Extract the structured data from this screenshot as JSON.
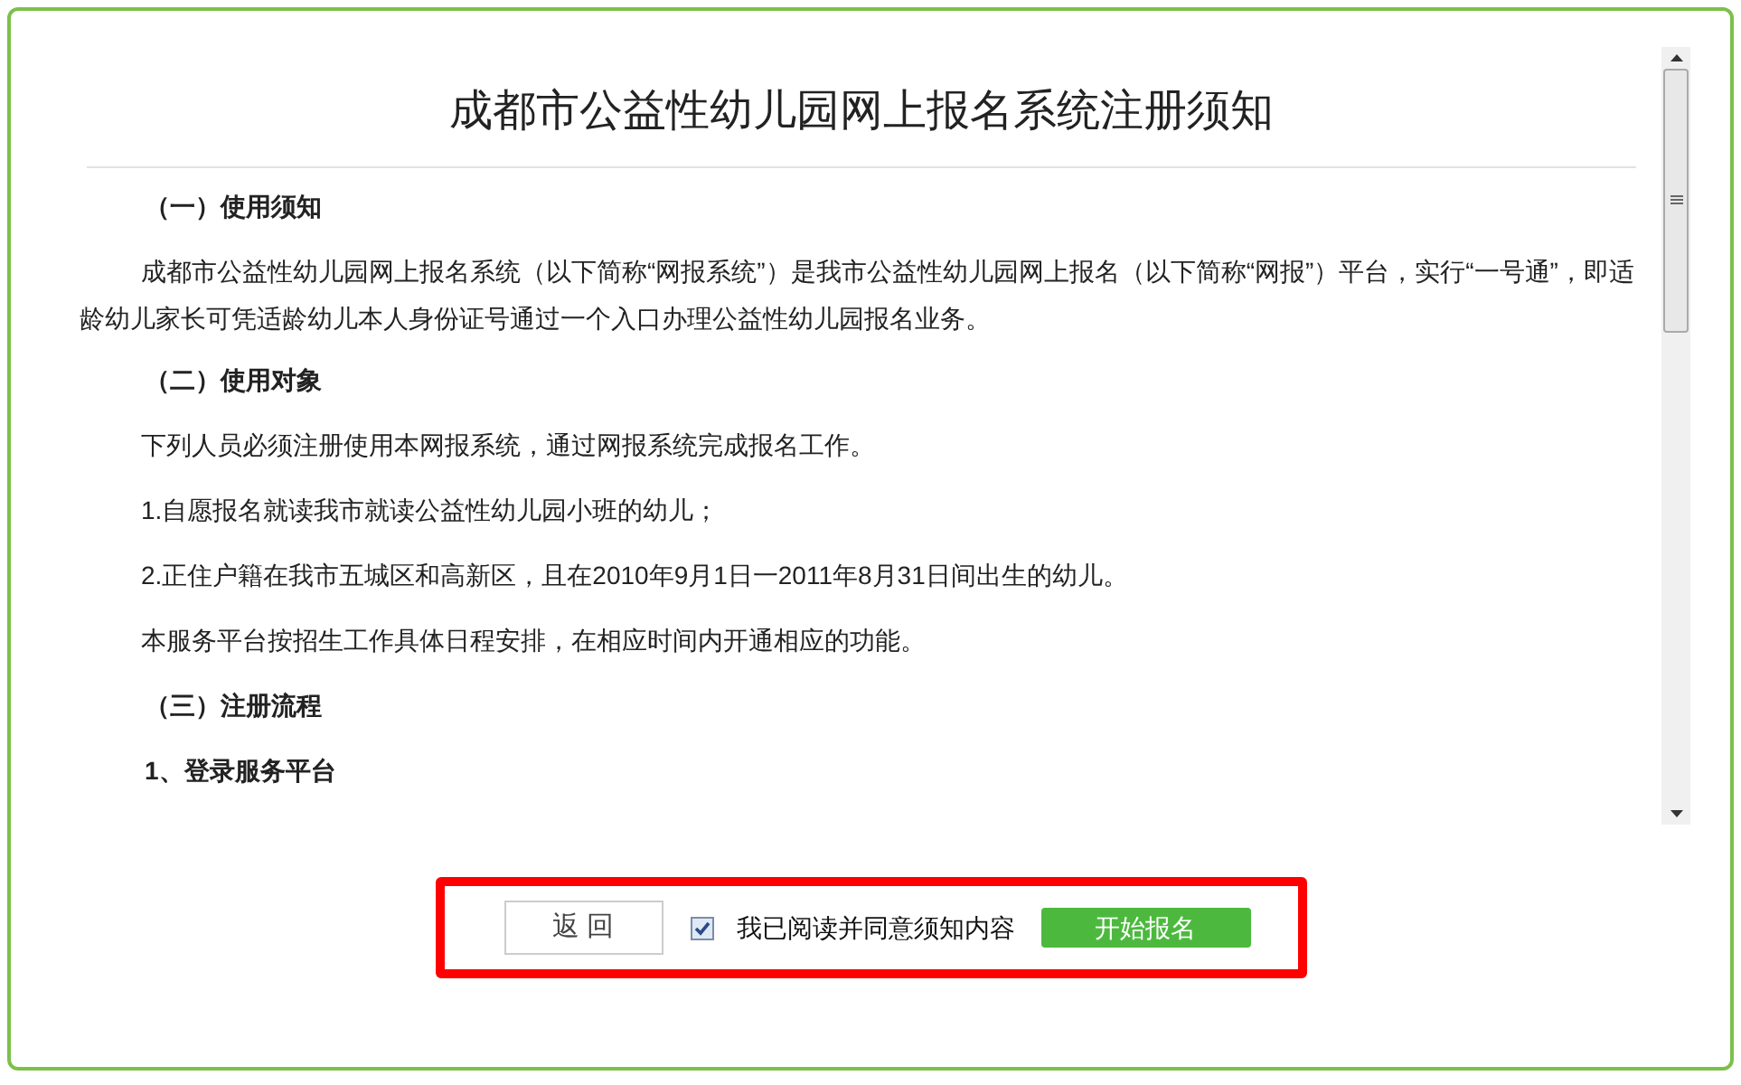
{
  "title": "成都市公益性幼儿园网上报名系统注册须知",
  "paragraphs": [
    {
      "kind": "heading",
      "text": "（一）使用须知"
    },
    {
      "kind": "indented",
      "text": "成都市公益性幼儿园网上报名系统（以下简称“网报系统”）是我市公益性幼儿园网上报名（以下简称“网报”）平台，实行“一号通”，即适龄幼儿家长可凭适龄幼儿本人身份证号通过一个入口办理公益性幼儿园报名业务。"
    },
    {
      "kind": "heading",
      "text": "（二）使用对象"
    },
    {
      "kind": "plain",
      "text": "下列人员必须注册使用本网报系统，通过网报系统完成报名工作。"
    },
    {
      "kind": "plain",
      "text": "1.自愿报名就读我市就读公益性幼儿园小班的幼儿；"
    },
    {
      "kind": "plain",
      "text": "2.正住户籍在我市五城区和高新区，且在2010年9月1日一2011年8月31日间出生的幼儿。"
    },
    {
      "kind": "plain",
      "text": "本服务平台按招生工作具体日程安排，在相应时间内开通相应的功能。"
    },
    {
      "kind": "heading",
      "text": "（三）注册流程"
    },
    {
      "kind": "heading",
      "text": "1、登录服务平台"
    }
  ],
  "back_button": "返 回",
  "agree": {
    "label": "我已阅读并同意须知内容",
    "checked": true
  },
  "start_button": "开始报名"
}
